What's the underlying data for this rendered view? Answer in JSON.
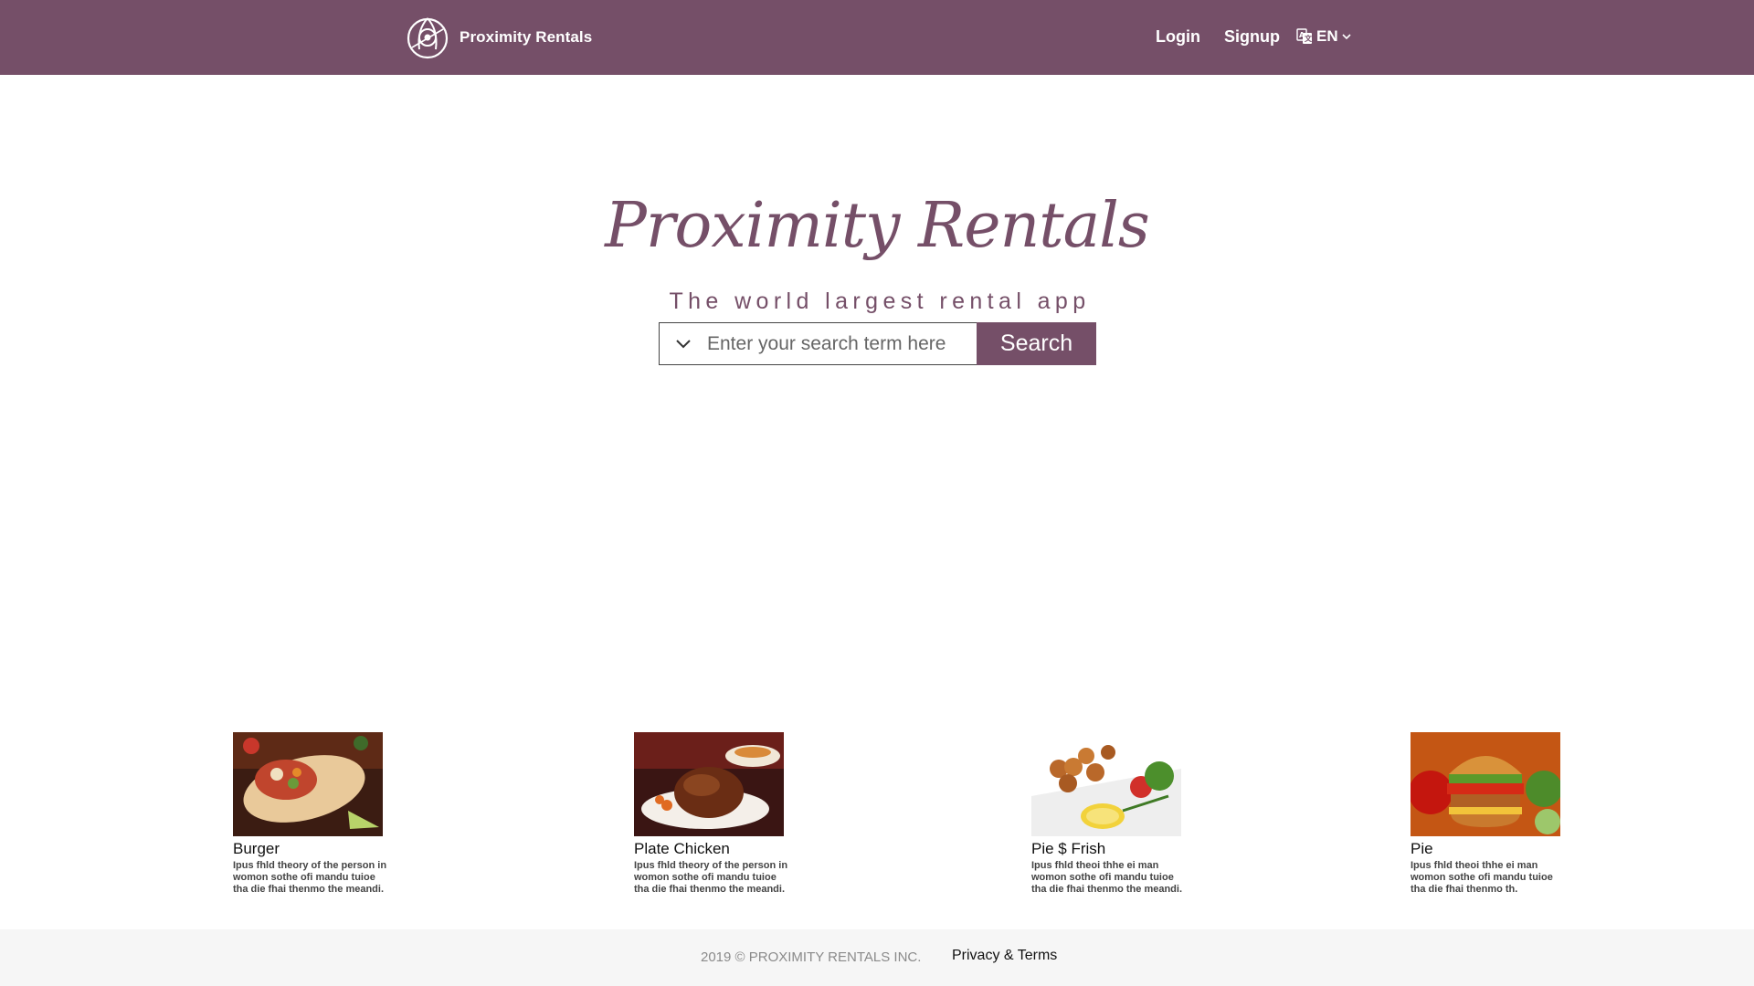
{
  "header": {
    "brand_name": "Proximity Rentals",
    "logo_icon": "proximity-rentals-logo-icon",
    "login_label": "Login",
    "signup_label": "Signup",
    "language": "EN",
    "language_icon": "translate-icon",
    "language_dropdown_icon": "chevron-down-icon"
  },
  "hero": {
    "title": "Proximity Rentals",
    "tagline": "The world largest rental app"
  },
  "search": {
    "placeholder": "Enter your search term here",
    "value": "",
    "button_label": "Search",
    "dropdown_icon": "chevron-down-icon"
  },
  "cards": [
    {
      "title": "Burger",
      "description": "Ipus fhld theory of the person in womon sothe ofi mandu tuioe tha die fhai thenmo the meandi.",
      "image": "burrito-food-image"
    },
    {
      "title": "Plate Chicken",
      "description": "Ipus fhld theory of the person in womon sothe ofi mandu tuioe tha die fhai thenmo the meandi.",
      "image": "roast-chicken-food-image"
    },
    {
      "title": "Pie $ Frish",
      "description": "Ipus fhld theoi thhe ei man womon sothe ofi mandu tuioe tha die fhai thenmo the meandi.",
      "image": "kebab-skewers-food-image"
    },
    {
      "title": "Pie",
      "description": "Ipus fhld theoi thhe ei man womon sothe ofi mandu tuioe tha die fhai thenmo th.",
      "image": "burger-food-image"
    }
  ],
  "footer": {
    "copyright": "2019 © PROXIMITY RENTALS INC.",
    "privacy_label": "Privacy & Terms"
  },
  "colors": {
    "brand": "#754f68",
    "footer_bg": "#f6f6f6",
    "white": "#ffffff"
  }
}
